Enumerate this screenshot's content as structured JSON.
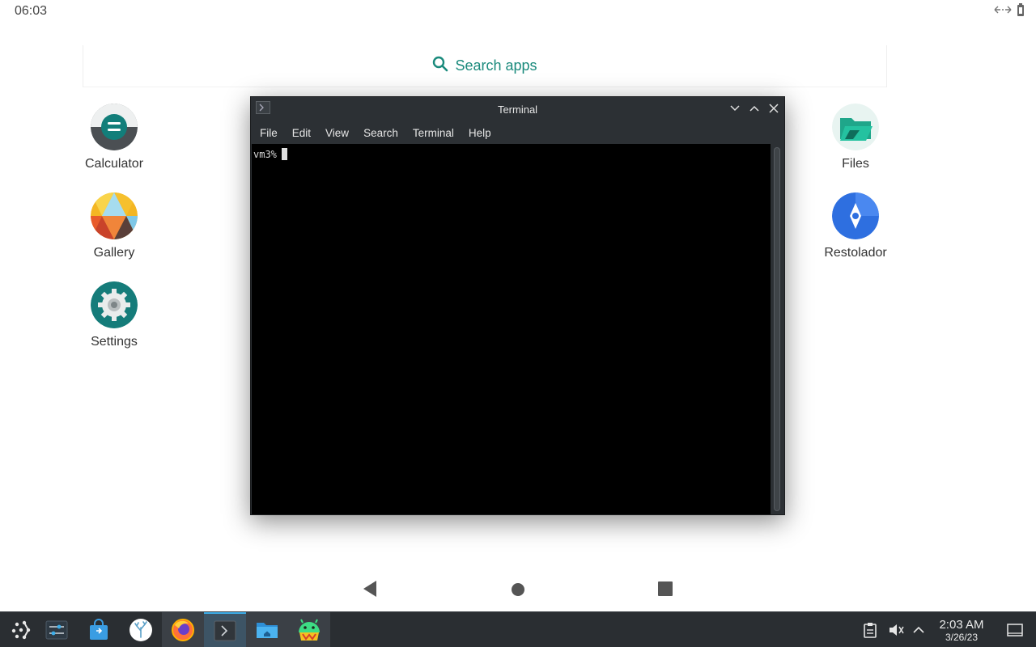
{
  "status_bar": {
    "time": "06:03",
    "icons": [
      "link-arrows-icon",
      "battery-icon"
    ]
  },
  "search": {
    "placeholder": "Search apps",
    "icon": "search-icon",
    "accent": "#1a8a7c"
  },
  "apps_left": [
    {
      "label": "Calculator",
      "icon": "calculator-icon"
    },
    {
      "label": "Gallery",
      "icon": "gallery-icon"
    },
    {
      "label": "Settings",
      "icon": "settings-icon"
    }
  ],
  "apps_right": [
    {
      "label": "Files",
      "icon": "files-icon"
    },
    {
      "label": "Restolador",
      "icon": "restolador-icon"
    }
  ],
  "terminal": {
    "title": "Terminal",
    "menu": [
      "File",
      "Edit",
      "View",
      "Search",
      "Terminal",
      "Help"
    ],
    "prompt": "vm3%",
    "controls": [
      "minimize-icon",
      "maximize-icon",
      "close-icon"
    ]
  },
  "nav_buttons": [
    "back-icon",
    "home-icon",
    "recents-icon"
  ],
  "taskbar": {
    "items": [
      "app-launcher-icon",
      "system-settings-icon",
      "discover-store-icon",
      "coral-app-icon",
      "firefox-icon",
      "konsole-icon",
      "dolphin-files-icon",
      "android-app-icon"
    ],
    "active_item": "konsole-icon",
    "tray_icons": [
      "clipboard-icon",
      "volume-muted-icon",
      "tray-expand-icon",
      "show-desktop-icon"
    ],
    "clock_time": "2:03 AM",
    "clock_date": "3/26/23"
  }
}
